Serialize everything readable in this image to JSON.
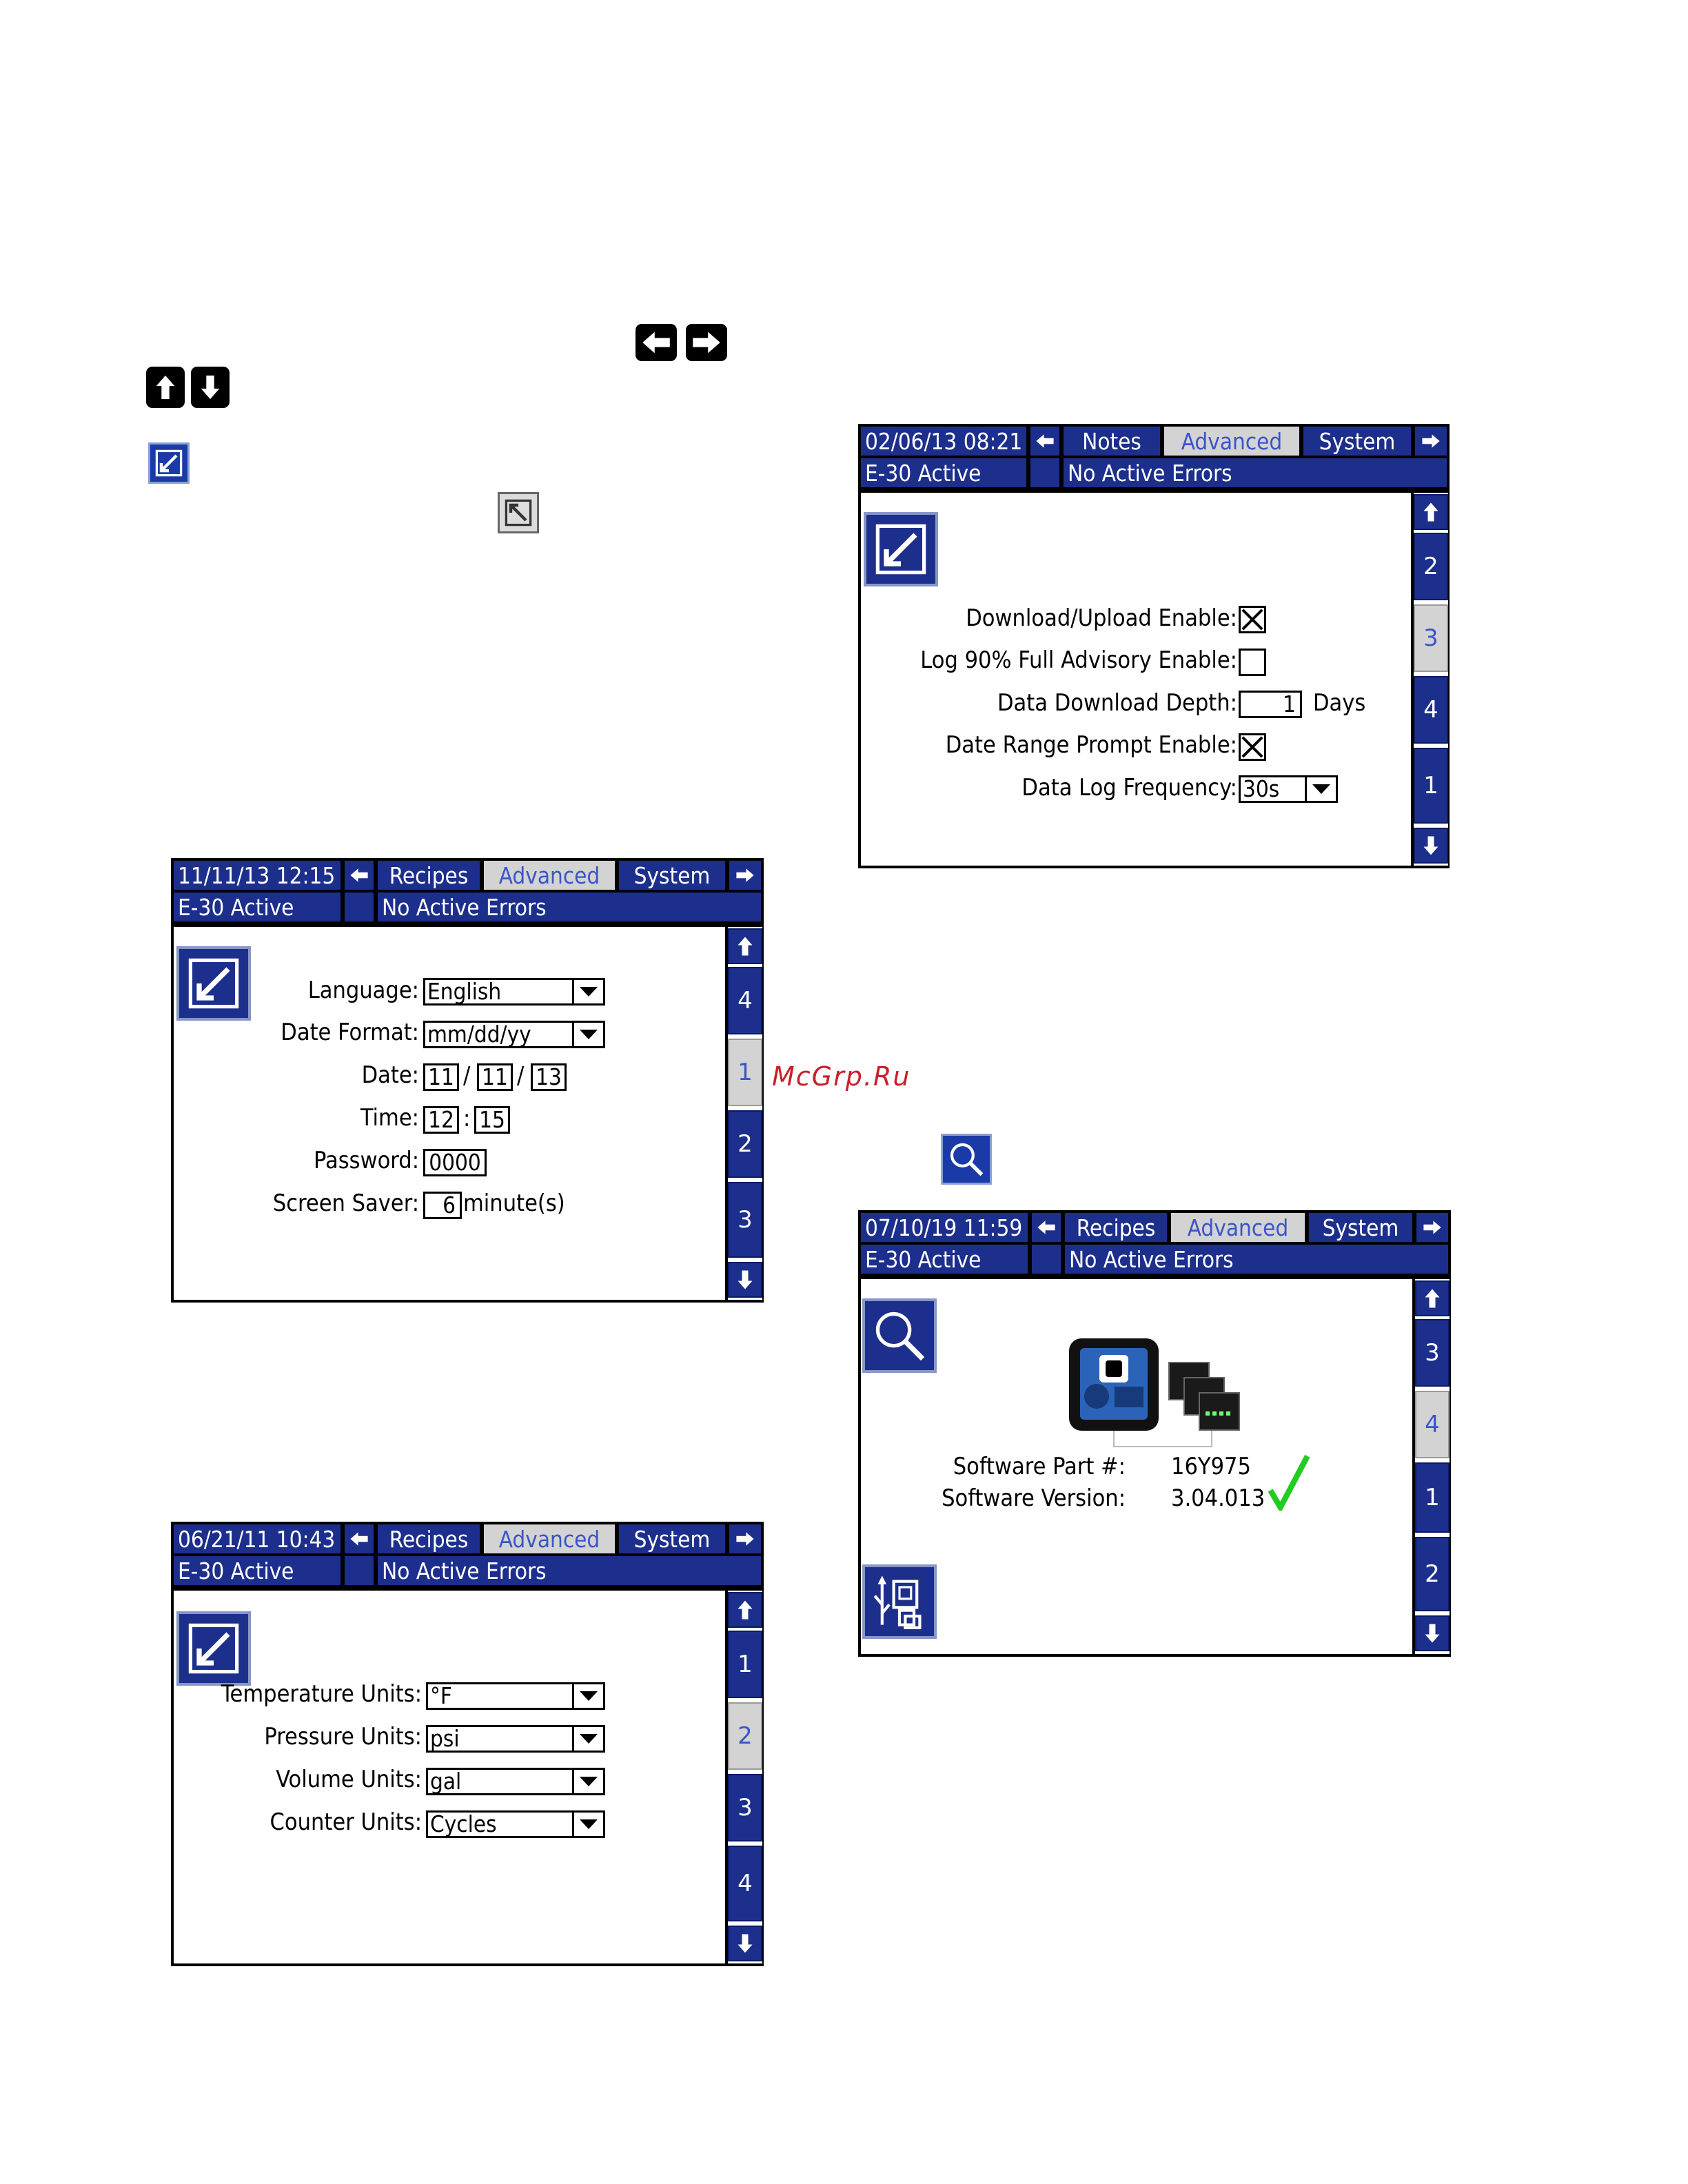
{
  "watermark": "McGrp.Ru",
  "screen1": {
    "datetime": "02/06/13 08:21",
    "tabs": [
      "Notes",
      "Advanced",
      "System"
    ],
    "selected_tab": "Advanced",
    "status_left": "E-30 Active",
    "status_right": "No Active Errors",
    "pages": [
      "2",
      "3",
      "4",
      "1"
    ],
    "selected_page": "3",
    "fields": {
      "download_upload_label": "Download/Upload Enable:",
      "download_upload_checked": true,
      "log90_label": "Log 90% Full Advisory Enable:",
      "log90_checked": false,
      "depth_label": "Data Download Depth:",
      "depth_value": "1",
      "depth_unit": "Days",
      "range_prompt_label": "Date Range Prompt Enable:",
      "range_prompt_checked": true,
      "log_freq_label": "Data Log Frequency:",
      "log_freq_value": "30s"
    }
  },
  "screen2": {
    "datetime": "11/11/13 12:15",
    "tabs": [
      "Recipes",
      "Advanced",
      "System"
    ],
    "selected_tab": "Advanced",
    "status_left": "E-30 Active",
    "status_right": "No Active Errors",
    "pages": [
      "4",
      "1",
      "2",
      "3"
    ],
    "selected_page": "1",
    "fields": {
      "language_label": "Language:",
      "language_value": "English",
      "date_format_label": "Date Format:",
      "date_format_value": "mm/dd/yy",
      "date_label": "Date:",
      "date_mm": "11",
      "date_dd": "11",
      "date_yy": "13",
      "date_sep": "/",
      "time_label": "Time:",
      "time_hh": "12",
      "time_mm": "15",
      "time_sep": ":",
      "password_label": "Password:",
      "password_value": "0000",
      "screensaver_label": "Screen Saver:",
      "screensaver_value": "6",
      "screensaver_unit": "minute(s)"
    }
  },
  "screen3": {
    "datetime": "07/10/19 11:59",
    "tabs": [
      "Recipes",
      "Advanced",
      "System"
    ],
    "selected_tab": "Advanced",
    "status_left": "E-30 Active",
    "status_right": "No Active Errors",
    "pages": [
      "3",
      "4",
      "1",
      "2"
    ],
    "selected_page": "4",
    "software_part_label": "Software Part #:",
    "software_part_value": "16Y975",
    "software_version_label": "Software Version:",
    "software_version_value": "3.04.013"
  },
  "screen4": {
    "datetime": "06/21/11 10:43",
    "tabs": [
      "Recipes",
      "Advanced",
      "System"
    ],
    "selected_tab": "Advanced",
    "status_left": "E-30 Active",
    "status_right": "No Active Errors",
    "pages": [
      "1",
      "2",
      "3",
      "4"
    ],
    "selected_page": "2",
    "fields": {
      "temp_label": "Temperature Units:",
      "temp_value": "°F",
      "pressure_label": "Pressure Units:",
      "pressure_value": "psi",
      "volume_label": "Volume Units:",
      "volume_value": "gal",
      "counter_label": "Counter Units:",
      "counter_value": "Cycles"
    }
  },
  "colors": {
    "header_blue": "#1d2f8c",
    "selected_grey": "#d3d3d3",
    "check_green": "#22cc22"
  },
  "icons": [
    "left-arrow-key-icon",
    "right-arrow-key-icon",
    "up-arrow-key-icon",
    "down-arrow-key-icon",
    "edit-screen-icon",
    "exit-edit-icon",
    "magnifier-icon",
    "usb-icon"
  ]
}
